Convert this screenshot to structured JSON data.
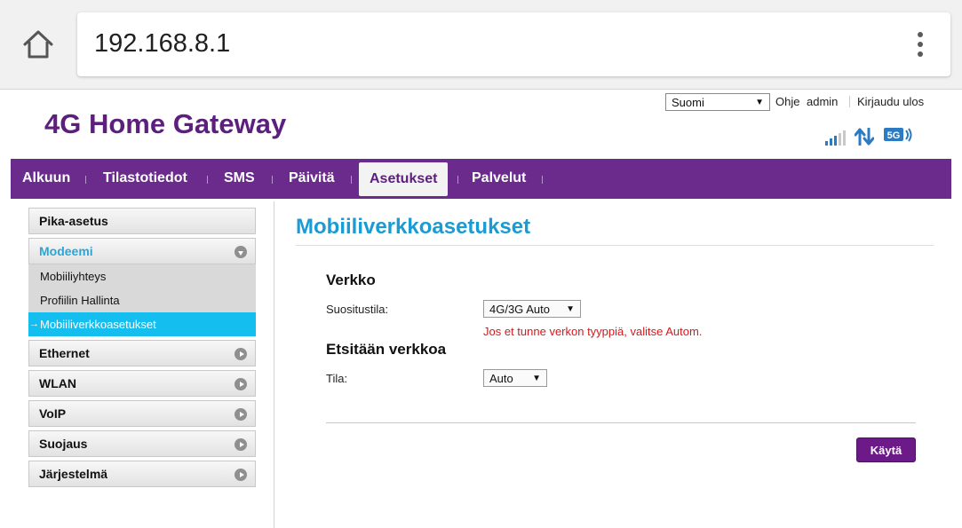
{
  "browser": {
    "url": "192.168.8.1",
    "home_icon": "home-icon",
    "menu_icon": "more-vert-icon"
  },
  "header": {
    "brand": "4G Home Gateway",
    "language": "Suomi",
    "help": "Ohje",
    "user": "admin",
    "logout": "Kirjaudu ulos",
    "signal_bars_lit": 3,
    "signal_bars_total": 5,
    "network_type": "5G",
    "icons": [
      "signal-strength-icon",
      "data-transfer-icon",
      "network-5g-icon"
    ]
  },
  "nav": {
    "items": [
      {
        "label": "Alkuun"
      },
      {
        "label": "Tilastotiedot"
      },
      {
        "label": "SMS"
      },
      {
        "label": "Päivitä"
      },
      {
        "label": "Asetukset",
        "active": true
      },
      {
        "label": "Palvelut"
      }
    ]
  },
  "sidebar": {
    "items": [
      {
        "label": "Pika-asetus"
      },
      {
        "label": "Modeemi",
        "expanded": true,
        "children": [
          {
            "label": "Mobiiliyhteys"
          },
          {
            "label": "Profiilin Hallinta"
          },
          {
            "label": "Mobiiliverkkoasetukset",
            "active": true
          }
        ]
      },
      {
        "label": "Ethernet"
      },
      {
        "label": "WLAN"
      },
      {
        "label": "VoIP"
      },
      {
        "label": "Suojaus"
      },
      {
        "label": "Järjestelmä"
      }
    ]
  },
  "content": {
    "title": "Mobiiliverkkoasetukset",
    "network": {
      "heading": "Verkko",
      "preferred_mode_label": "Suositustila:",
      "preferred_mode_value": "4G/3G Auto",
      "hint": "Jos et tunne verkon tyyppiä, valitse Autom."
    },
    "search": {
      "heading": "Etsitään verkkoa",
      "mode_label": "Tila:",
      "mode_value": "Auto"
    },
    "apply_label": "Käytä"
  },
  "colors": {
    "brand": "#5c1f7e",
    "nav_bg": "#6a2b8d",
    "title": "#1a9bd4",
    "active_sub": "#14bff0",
    "hint": "#d8171b",
    "apply_bg": "#6b1a87"
  }
}
